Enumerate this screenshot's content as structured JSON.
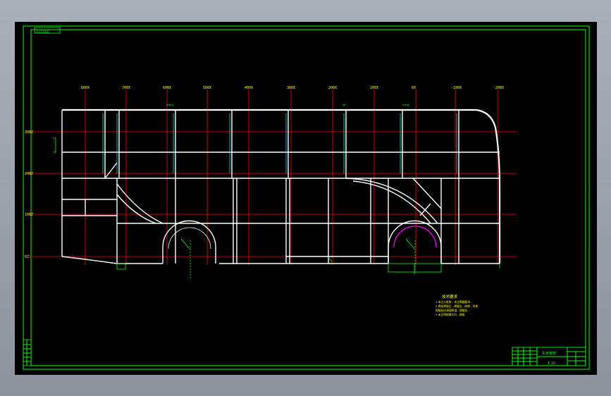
{
  "colors": {
    "background": "#000000",
    "border": "#00ff00",
    "structure": "#ffffff",
    "reference": "#ff0000",
    "dimension": "#00ff00",
    "notes": "#ffff00",
    "pillar": "#00ffff",
    "arc": "#ff00ff"
  },
  "sheet": {
    "stamp": "□□□□□□□"
  },
  "stations": [
    "800X",
    "700X",
    "600X",
    "500X",
    "400X",
    "300X",
    "200X",
    "100X",
    "0X",
    "-100X",
    "-200X"
  ],
  "levels": [
    "300Z",
    "200Z",
    "100Z",
    "0Z"
  ],
  "notes": {
    "title": "技术要求",
    "lines": [
      "1.未注公差按...未注焊缝要求...",
      "2.骨架焊接后...焊缝应...除锈...涂漆",
      "焊接处应清理焊渣...焊缝应...",
      "3.未注明焊缝均为...焊接"
    ]
  },
  "title_block": {
    "drawing_name": "车身骨架",
    "scale": "1:10"
  }
}
